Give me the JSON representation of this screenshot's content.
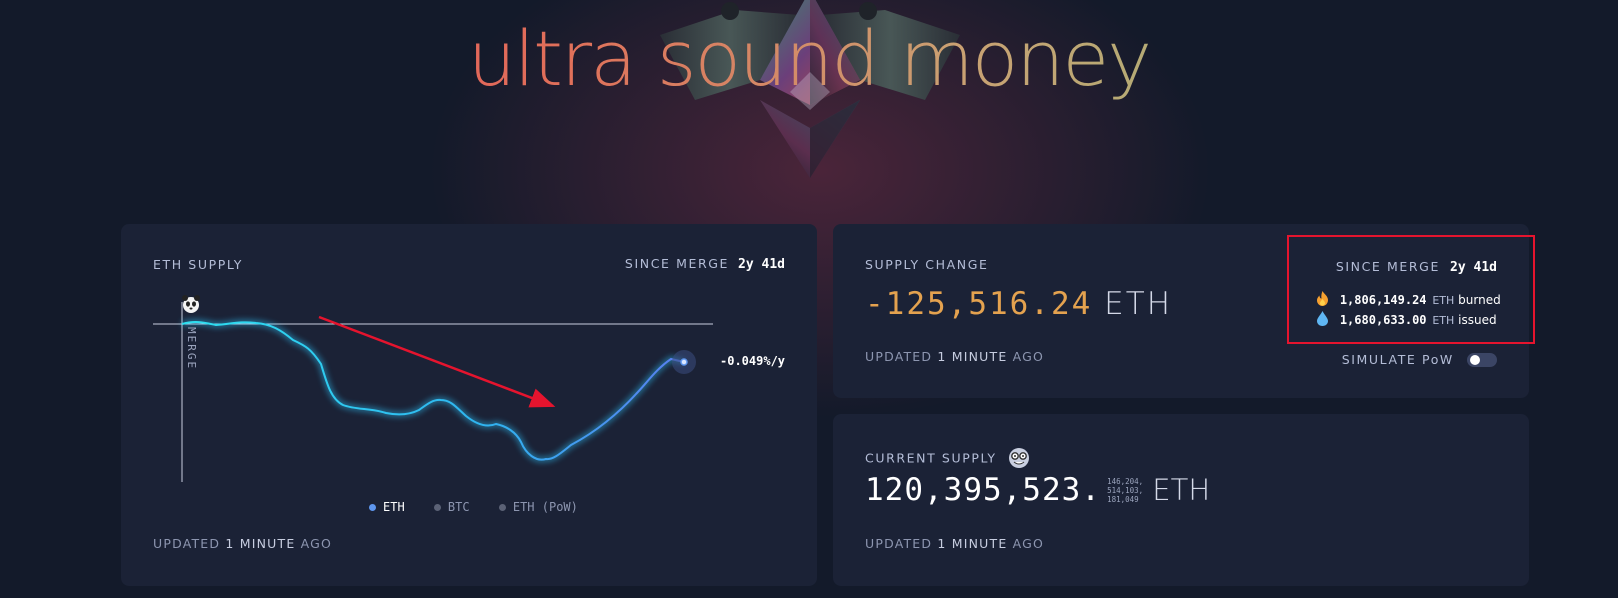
{
  "header": {
    "title": "ultra sound money"
  },
  "supply_panel": {
    "label": "ETH SUPPLY",
    "since_label": "SINCE MERGE",
    "since_value": "2y 41d",
    "merge_label": "MERGE",
    "rate": "-0.049%/y",
    "legend": [
      {
        "label": "ETH",
        "color": "#5e96ee"
      },
      {
        "label": "BTC",
        "color": "#5b6276"
      },
      {
        "label": "ETH (PoW)",
        "color": "#5b6276"
      }
    ],
    "updated_prefix": "UPDATED",
    "updated_value": "1 MINUTE",
    "updated_suffix": "AGO"
  },
  "supply_change": {
    "label": "SUPPLY CHANGE",
    "value": "-125,516.24",
    "unit": "ETH",
    "since_label": "SINCE MERGE",
    "since_value": "2y 41d",
    "burned_value": "1,806,149.24",
    "burned_unit": "ETH",
    "burned_label": "burned",
    "issued_value": "1,680,633.00",
    "issued_unit": "ETH",
    "issued_label": "issued",
    "simulate_label": "SIMULATE PoW",
    "simulate_on": false,
    "updated_prefix": "UPDATED",
    "updated_value": "1 MINUTE",
    "updated_suffix": "AGO"
  },
  "current_supply": {
    "label": "CURRENT SUPPLY",
    "value_main": "120,395,523.",
    "decimals_line1": "146,204,",
    "decimals_line2": "514,103,",
    "decimals_line3": "181,049",
    "unit": "ETH",
    "updated_prefix": "UPDATED",
    "updated_value": "1 MINUTE",
    "updated_suffix": "AGO"
  },
  "colors": {
    "accent_orange": "#e4a24f",
    "eth_line": "#28c8f0",
    "annotation_red": "#e5142e"
  },
  "icons": [
    "ethereum-logo",
    "panda-icon",
    "fire-icon",
    "droplet-icon",
    "nerd-face-icon"
  ]
}
